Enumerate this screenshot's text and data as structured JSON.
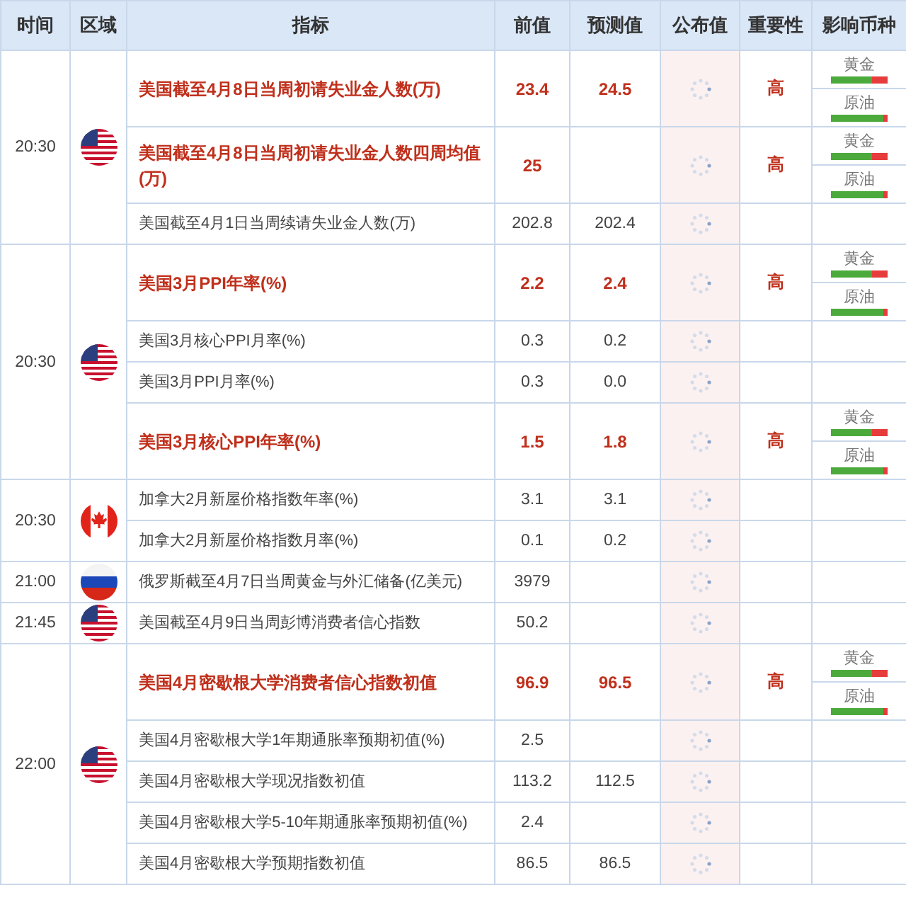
{
  "columns": [
    "时间",
    "区域",
    "指标",
    "前值",
    "预测值",
    "公布值",
    "重要性",
    "影响币种"
  ],
  "groups": [
    {
      "time": "20:30",
      "flag": {
        "kind": "us"
      },
      "rows": [
        {
          "indicator": "美国截至4月8日当周初请失业金人数(万)",
          "previous": "23.4",
          "forecast": "24.5",
          "highlight": true,
          "importance": "高",
          "impacts": [
            {
              "name": "黄金",
              "level": 0.72
            },
            {
              "name": "原油",
              "level": 0.92
            }
          ]
        },
        {
          "indicator": "美国截至4月8日当周初请失业金人数四周均值(万)",
          "previous": "25",
          "highlight": true,
          "importance": "高",
          "impacts": [
            {
              "name": "黄金",
              "level": 0.72
            },
            {
              "name": "原油",
              "level": 0.92
            }
          ]
        },
        {
          "indicator": "美国截至4月1日当周续请失业金人数(万)",
          "previous": "202.8",
          "forecast": "202.4",
          "highlight": false
        }
      ]
    },
    {
      "time": "20:30",
      "flag": {
        "kind": "us"
      },
      "rows": [
        {
          "indicator": "美国3月PPI年率(%)",
          "previous": "2.2",
          "forecast": "2.4",
          "highlight": true,
          "importance": "高",
          "impacts": [
            {
              "name": "黄金",
              "level": 0.72
            },
            {
              "name": "原油",
              "level": 0.92
            }
          ]
        },
        {
          "indicator": "美国3月核心PPI月率(%)",
          "previous": "0.3",
          "forecast": "0.2",
          "highlight": false
        },
        {
          "indicator": "美国3月PPI月率(%)",
          "previous": "0.3",
          "forecast": "0.0",
          "highlight": false
        },
        {
          "indicator": "美国3月核心PPI年率(%)",
          "previous": "1.5",
          "forecast": "1.8",
          "highlight": true,
          "importance": "高",
          "impacts": [
            {
              "name": "黄金",
              "level": 0.72
            },
            {
              "name": "原油",
              "level": 0.92
            }
          ]
        }
      ]
    },
    {
      "time": "20:30",
      "flag": {
        "kind": "ca"
      },
      "rows": [
        {
          "indicator": "加拿大2月新屋价格指数年率(%)",
          "previous": "3.1",
          "forecast": "3.1",
          "highlight": false
        },
        {
          "indicator": "加拿大2月新屋价格指数月率(%)",
          "previous": "0.1",
          "forecast": "0.2",
          "highlight": false
        }
      ]
    },
    {
      "time": "21:00",
      "flag": {
        "kind": "ru"
      },
      "rows": [
        {
          "indicator": "俄罗斯截至4月7日当周黄金与外汇储备(亿美元)",
          "previous": "3979",
          "highlight": false
        }
      ]
    },
    {
      "time": "21:45",
      "flag": {
        "kind": "us"
      },
      "rows": [
        {
          "indicator": "美国截至4月9日当周彭博消费者信心指数",
          "previous": "50.2",
          "highlight": false
        }
      ]
    },
    {
      "time": "22:00",
      "flag": {
        "kind": "us"
      },
      "rows": [
        {
          "indicator": "美国4月密歇根大学消费者信心指数初值",
          "previous": "96.9",
          "forecast": "96.5",
          "highlight": true,
          "importance": "高",
          "impacts": [
            {
              "name": "黄金",
              "level": 0.72
            },
            {
              "name": "原油",
              "level": 0.92
            }
          ]
        },
        {
          "indicator": "美国4月密歇根大学1年期通胀率预期初值(%)",
          "previous": "2.5",
          "highlight": false
        },
        {
          "indicator": "美国4月密歇根大学现况指数初值",
          "previous": "113.2",
          "forecast": "112.5",
          "highlight": false
        },
        {
          "indicator": "美国4月密歇根大学5-10年期通胀率预期初值(%)",
          "previous": "2.4",
          "highlight": false
        },
        {
          "indicator": "美国4月密歇根大学预期指数初值",
          "previous": "86.5",
          "forecast": "86.5",
          "highlight": false
        }
      ]
    }
  ]
}
